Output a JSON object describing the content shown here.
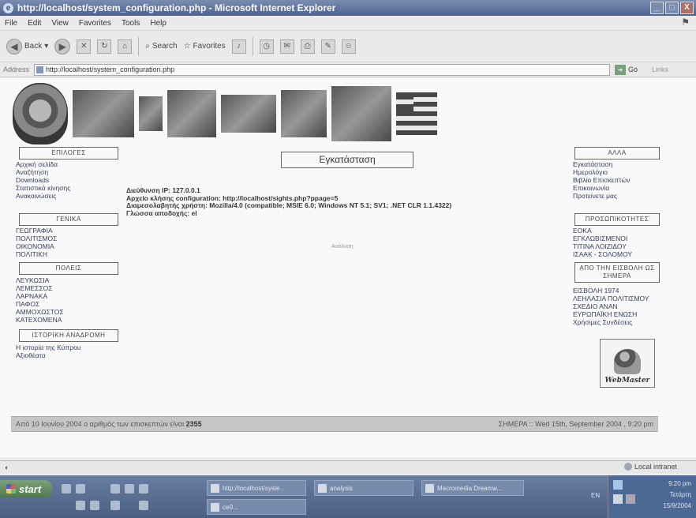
{
  "window": {
    "title": "http://localhost/system_configuration.php - Microsoft Internet Explorer",
    "controls": [
      "_",
      "□",
      "X"
    ]
  },
  "menu": [
    "File",
    "Edit",
    "View",
    "Favorites",
    "Tools",
    "Help"
  ],
  "toolbar": {
    "back_label": "Back",
    "search_label": "Search",
    "favorites_label": "Favorites"
  },
  "address": {
    "label": "Address",
    "url": "http://localhost/system_configuration.php",
    "go_label": "Go",
    "links_label": "Links"
  },
  "left_sidebar": {
    "sections": [
      {
        "title": "ΕΠΙΛΟΓΕΣ",
        "items": [
          "Αρχική σελίδα",
          "Αναζήτηση",
          "Downloads",
          "Στατιστικά κίνησης",
          "Ανακοινώσεις"
        ]
      },
      {
        "title": "ΓΕΝΙΚΑ",
        "items": [
          "ΓΕΩΓΡΑΦΙΑ",
          "ΠΟΛΙΤΙΣΜΟΣ",
          "ΟΙΚΟΝΟΜΙΑ",
          "ΠΟΛΙΤΙΚΗ"
        ]
      },
      {
        "title": "ΠΟΛΕΙΣ",
        "items": [
          "ΛΕΥΚΩΣΙΑ",
          "ΛΕΜΕΣΣΟΣ",
          "ΛΑΡΝΑΚΑ",
          "ΠΑΦΟΣ",
          "ΑΜΜΟΧΩΣΤΟΣ",
          "ΚΑΤΕΧΟΜΕΝΑ"
        ]
      },
      {
        "title": "ΙΣΤΟΡΙΚΗ ΑΝΑΔΡΟΜΗ",
        "items": [
          "Η ιστορία της Κύπρου",
          "Αξιοθέατα"
        ]
      }
    ]
  },
  "right_sidebar": {
    "sections": [
      {
        "title": "ΑΛΛΑ",
        "items": [
          "Εγκατάσταση",
          "Ημερολόγιο",
          "Βιβλίο Επισκεπτών",
          "Επικοινωνία",
          "Προτείνετε μας"
        ]
      },
      {
        "title": "ΠΡΟΣΩΠΙΚΟΤΗΤΕΣ",
        "items": [
          "ΕΟΚΑ",
          "ΕΓΚΛΩΒΙΣΜΕΝΟΙ",
          "ΤΙΤΙΝΑ ΛΟΙΖΙΔΟΥ",
          "ΙΣΑΑΚ - ΣΟΛΟΜΟΥ"
        ]
      },
      {
        "title": "ΑΠΟ ΤΗΝ ΕΙΣΒΟΛΗ ΩΣ ΣΗΜΕΡΑ",
        "items": [
          "ΕΙΣΒΟΛΗ 1974",
          "ΛΕΗΛΑΣΙΑ ΠΟΛΙΤΙΣΜΟΥ",
          "ΣΧΕΔΙΟ ΑΝΑΝ",
          "ΕΥΡΩΠΑΪΚΗ ΕΝΩΣΗ",
          "Χρήσιμες Συνδέσεις"
        ]
      }
    ],
    "webmaster_label": "WebMaster"
  },
  "main": {
    "title": "Εγκατάσταση",
    "info": [
      "Διεύθυνση IP: 127.0.0.1",
      "Αρχείο κλήσης configuration: http://localhost/sights.php?ppage=5",
      "Διαμεσολαβητής χρήστη: Mozilla/4.0 (compatible; MSIE 6.0; Windows NT 5.1; SV1; .NET CLR 1.1.4322)",
      "Γλώσσα αποδοχής: el"
    ],
    "note": "Ανάλυση"
  },
  "footer": {
    "left_prefix": "Από 10 Ιουνίου 2004 ο αριθμός των επισκεπτών είναι",
    "visitor_count": "2355",
    "right": "ΣΗΜΕΡΑ :: Wed 15th, September 2004 , 9:20 pm"
  },
  "status": {
    "zone": "Local intranet"
  },
  "taskbar": {
    "start_label": "start",
    "tasks": [
      "http://localhost/syste...",
      "analysis",
      "Macromedia Dreamw...",
      "ce0..."
    ],
    "tray_lang": "EN",
    "clock": "9:20 pm",
    "day": "Τετάρτη",
    "date": "15/9/2004"
  },
  "colors": {
    "titlebar": "#3f63a9",
    "link": "#2a3c6a",
    "footer_bg": "#c9c9c9",
    "start_green": "#3f7f3a"
  }
}
